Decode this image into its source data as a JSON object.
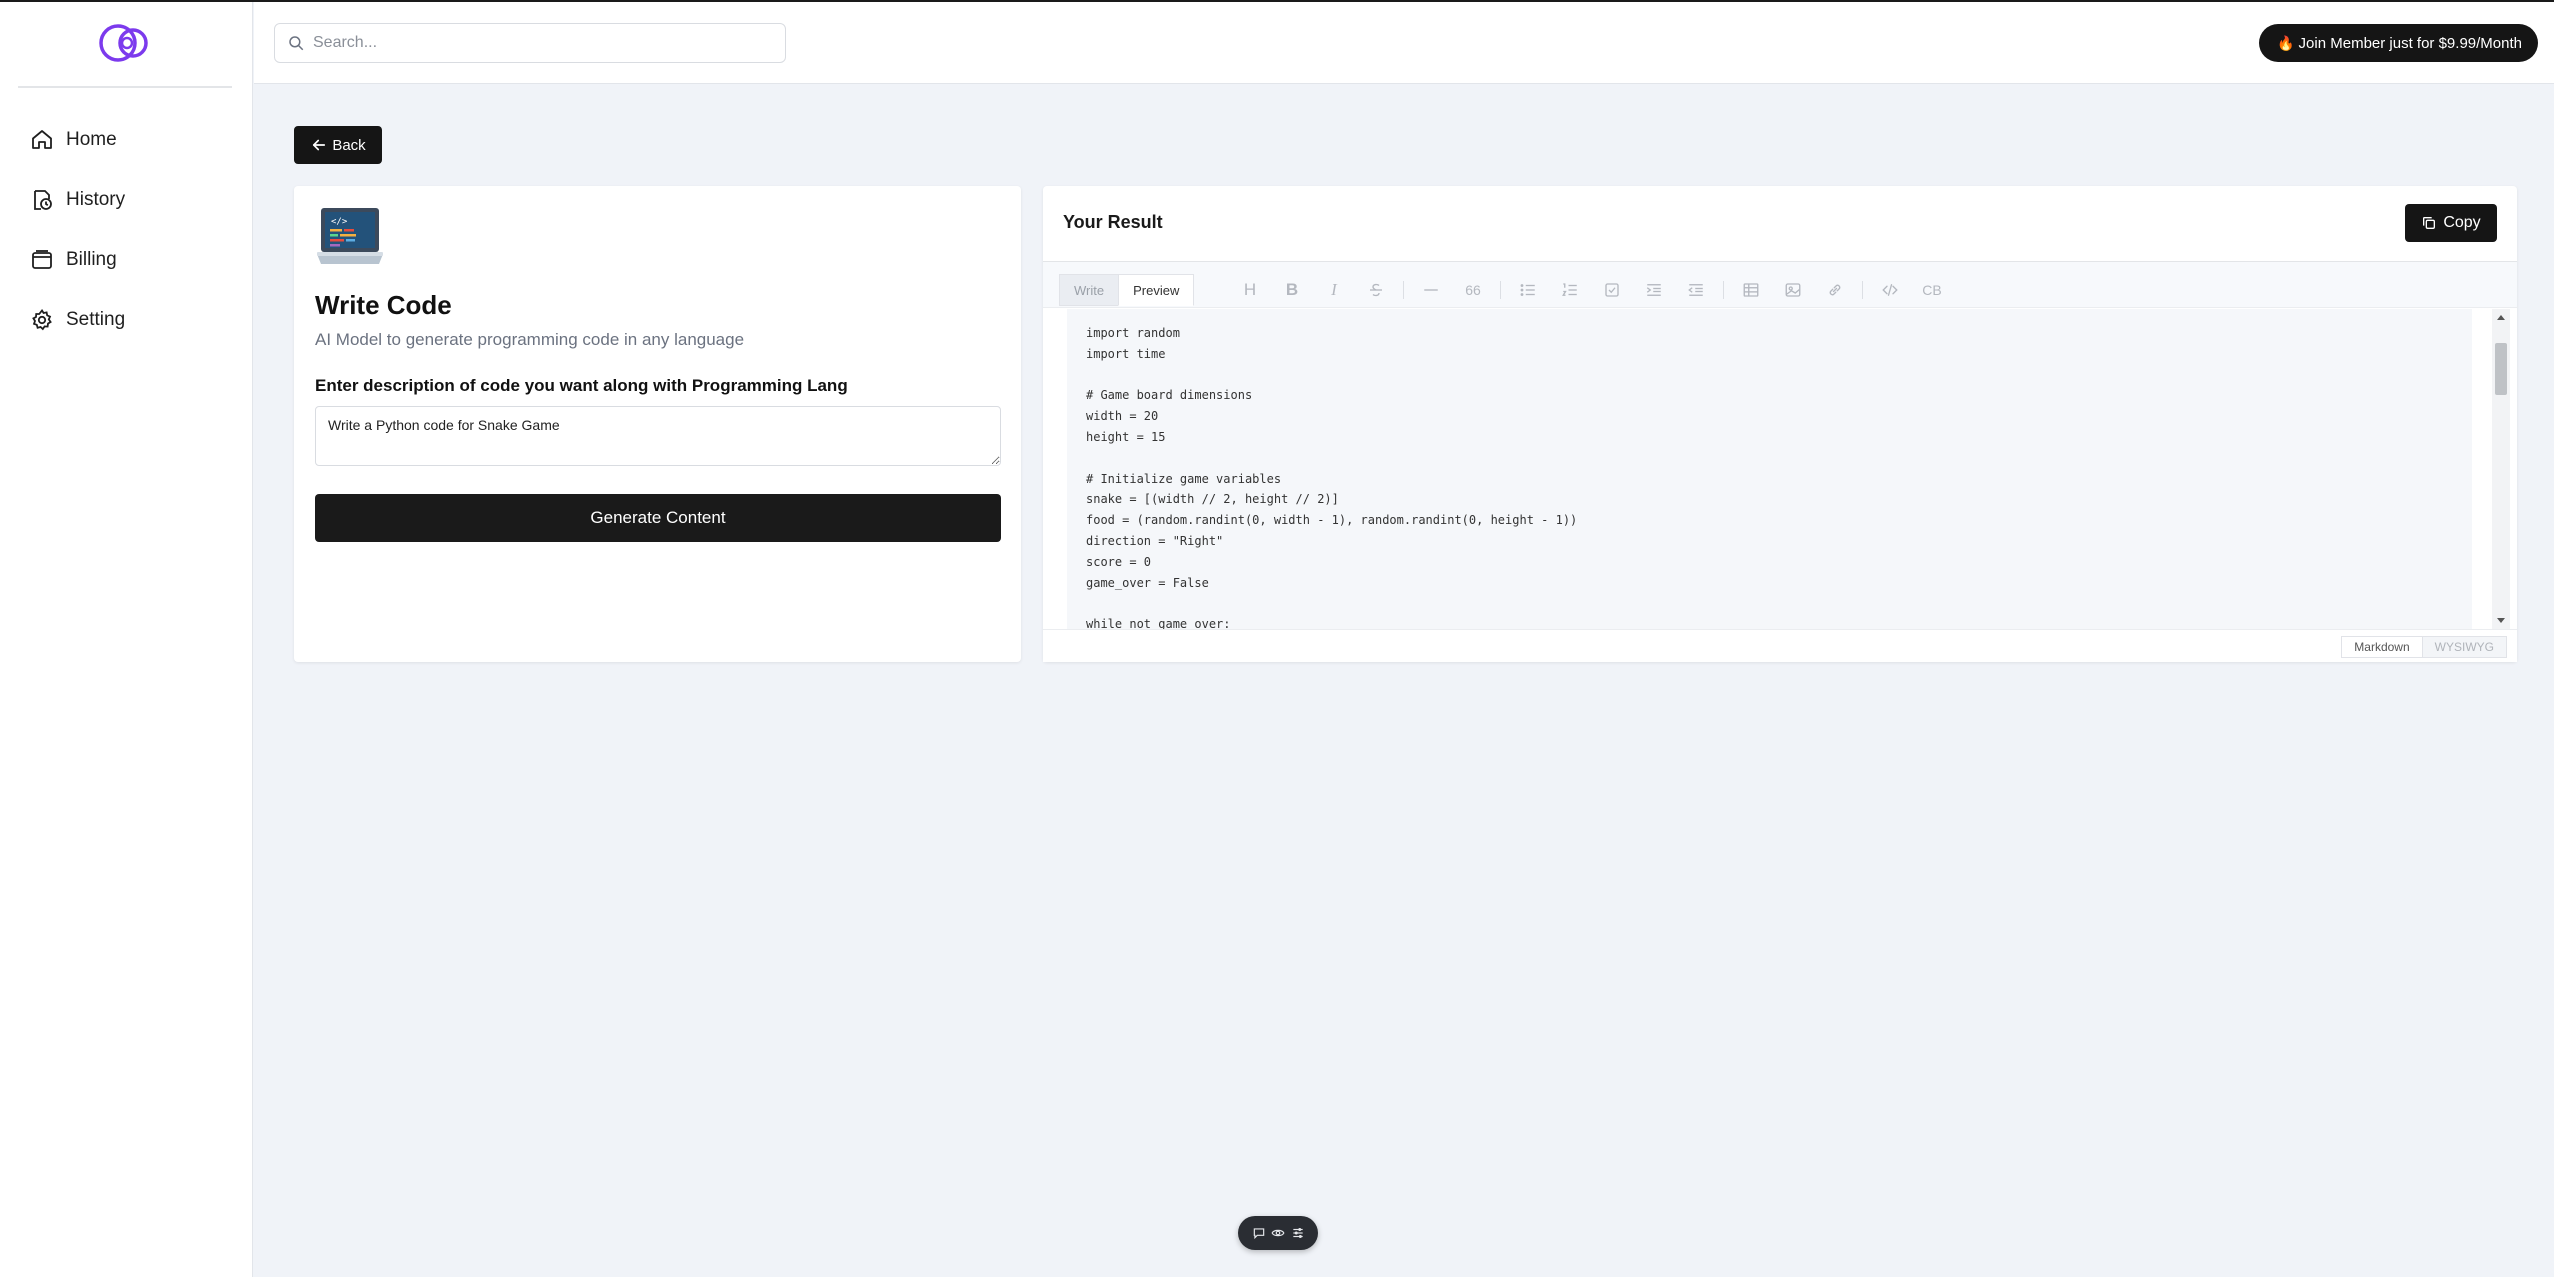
{
  "sidebar": {
    "logo": "logo-icon",
    "items": [
      {
        "label": "Home",
        "icon": "home-icon"
      },
      {
        "label": "History",
        "icon": "history-icon"
      },
      {
        "label": "Billing",
        "icon": "wallet-icon"
      },
      {
        "label": "Setting",
        "icon": "gear-icon"
      }
    ]
  },
  "header": {
    "search_placeholder": "Search...",
    "join_label": "Join Member just for $9.99/Month"
  },
  "back_label": "Back",
  "form": {
    "title": "Write Code",
    "subtitle": "AI Model to generate programming code in any language",
    "field_label": "Enter description of code you want along with Programming Lang",
    "field_value": "Write a Python code for Snake Game",
    "generate_label": "Generate Content"
  },
  "result": {
    "title": "Your Result",
    "copy_label": "Copy",
    "tabs": {
      "write": "Write",
      "preview": "Preview"
    },
    "code": "import random\nimport time\n\n# Game board dimensions\nwidth = 20\nheight = 15\n\n# Initialize game variables\nsnake = [(width // 2, height // 2)]\nfood = (random.randint(0, width - 1), random.randint(0, height - 1))\ndirection = \"Right\"\nscore = 0\ngame_over = False\n\nwhile not game_over:",
    "modes": {
      "markdown": "Markdown",
      "wysiwyg": "WYSIWYG"
    },
    "toolbar_text": {
      "heading": "H",
      "bold": "B",
      "italic": "I",
      "quote": "66",
      "codeblock": "CB"
    }
  },
  "colors": {
    "accent": "#7c3aed",
    "dark_button": "#151515",
    "page_bg": "#f0f3f8",
    "flame": "#ff8a1f"
  }
}
